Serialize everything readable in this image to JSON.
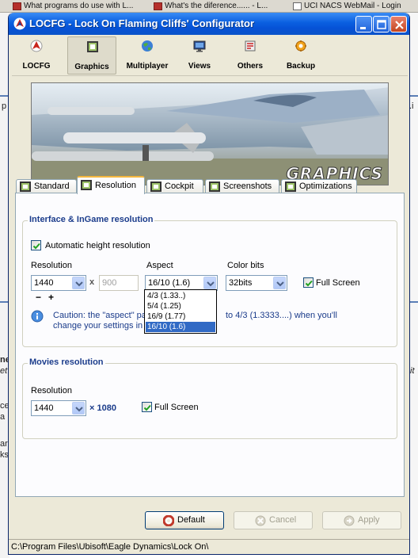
{
  "background": {
    "browser_tabs": [
      "What programs do use with L...",
      "What's the diference...... - L...",
      "UCI NACS WebMail - Login"
    ],
    "left_fragments": [
      "p",
      "ne",
      "et",
      "ce",
      "a",
      "ar",
      "ks"
    ],
    "right_fragments": [
      ".i",
      "it"
    ]
  },
  "window": {
    "title": "LOCFG - Lock On Flaming Cliffs' Configurator",
    "controls": {
      "minimize": "minimize",
      "maximize": "maximize",
      "close": "close"
    }
  },
  "toolbar": {
    "items": [
      {
        "label": "LOCFG",
        "icon": "locfg-logo-icon"
      },
      {
        "label": "Graphics",
        "icon": "graphics-icon",
        "active": true
      },
      {
        "label": "Multiplayer",
        "icon": "globe-icon"
      },
      {
        "label": "Views",
        "icon": "monitor-icon"
      },
      {
        "label": "Others",
        "icon": "others-icon"
      },
      {
        "label": "Backup",
        "icon": "backup-icon"
      }
    ]
  },
  "banner": {
    "text": "GRAPHICS"
  },
  "tabs": [
    {
      "label": "Standard"
    },
    {
      "label": "Resolution",
      "active": true
    },
    {
      "label": "Cockpit"
    },
    {
      "label": "Screenshots"
    },
    {
      "label": "Optimizations"
    }
  ],
  "interface": {
    "legend": "Interface & InGame resolution",
    "auto_height_label": "Automatic height resolution",
    "auto_height_checked": true,
    "resolution_label": "Resolution",
    "resolution_value": "1440",
    "x_sep": "x",
    "height_value": "900",
    "minus": "−",
    "plus": "+",
    "aspect_label": "Aspect",
    "aspect_value": "16/10 (1.6)",
    "aspect_options": [
      "4/3 (1.33..)",
      "5/4 (1.25)",
      "16/9 (1.77)",
      "16/10 (1.6)"
    ],
    "aspect_selected_index": 3,
    "colorbits_label": "Color bits",
    "colorbits_value": "32bits",
    "fullscreen_label": "Full Screen",
    "fullscreen_checked": true,
    "caution_line1_a": "Caution: the \"aspect\" pa",
    "caution_line1_b": "to 4/3 (1.3333....) when you'll",
    "caution_line2": "change your settings in L"
  },
  "movies": {
    "legend": "Movies resolution",
    "resolution_label": "Resolution",
    "resolution_value": "1440",
    "height_text": "× 1080",
    "fullscreen_label": "Full Screen",
    "fullscreen_checked": true
  },
  "buttons": {
    "default": "Default",
    "cancel": "Cancel",
    "apply": "Apply"
  },
  "status": {
    "path": "C:\\Program Files\\Ubisoft\\Eagle Dynamics\\Lock On\\"
  }
}
